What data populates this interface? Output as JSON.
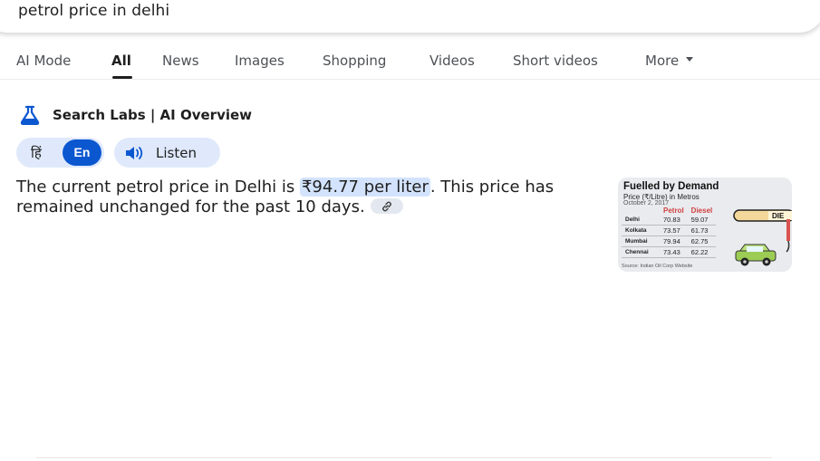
{
  "search": {
    "query": "petrol price in delhi"
  },
  "tabs": [
    {
      "label": "AI Mode"
    },
    {
      "label": "All",
      "active": true
    },
    {
      "label": "News"
    },
    {
      "label": "Images"
    },
    {
      "label": "Shopping"
    },
    {
      "label": "Videos"
    },
    {
      "label": "Short videos"
    },
    {
      "label": "More"
    }
  ],
  "ai_overview": {
    "header": "Search Labs | AI Overview",
    "language_hindi": "हिं",
    "language_english": "En",
    "listen_label": "Listen",
    "answer_before": "The current petrol price in Delhi is ",
    "answer_highlight": "₹94.77 per liter",
    "answer_after": ". This price has remained unchanged for the past 10 days."
  },
  "thumbnail": {
    "title": "Fuelled by Demand",
    "subtitle": "Price (₹/Litre) in Metros",
    "date": "October 2, 2017",
    "columns": [
      "Petrol",
      "Diesel"
    ],
    "rows": [
      {
        "city": "Delhi",
        "petrol": "70.83",
        "diesel": "59.07"
      },
      {
        "city": "Kolkata",
        "petrol": "73.57",
        "diesel": "61.73"
      },
      {
        "city": "Mumbai",
        "petrol": "79.94",
        "diesel": "62.75"
      },
      {
        "city": "Chennai",
        "petrol": "73.43",
        "diesel": "62.22"
      }
    ],
    "source": "Source: Indian Oil Corp Website",
    "pump_sign": "DIE"
  },
  "colors": {
    "accent": "#0b57d0",
    "chip_bg": "#dfe9fb",
    "highlight": "#d3e3fd"
  },
  "icons": {
    "labs": "flask-icon",
    "listen": "speaker-icon",
    "link": "link-icon"
  }
}
